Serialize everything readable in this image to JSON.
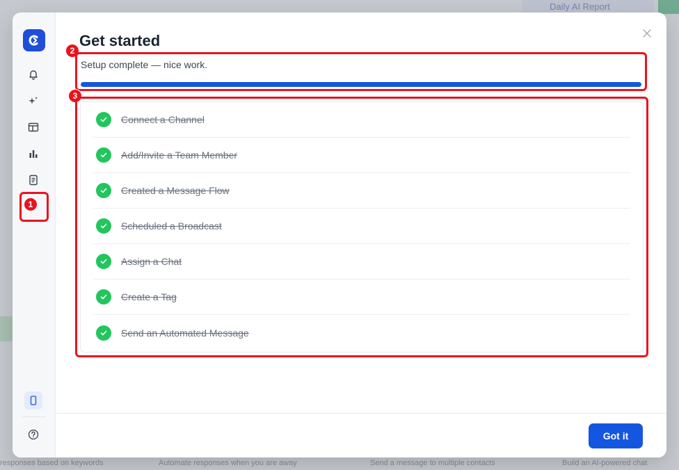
{
  "background": {
    "top_button_label": "Daily AI Report",
    "footer_texts": [
      "responses based on keywords",
      "Automate responses when you are away",
      "Send a message to multiple contacts",
      "Build an AI-powered chat"
    ]
  },
  "sidebar": {
    "logo_icon": "brand-logo-icon",
    "items": [
      {
        "icon": "bell-icon"
      },
      {
        "icon": "sparkle-icon"
      },
      {
        "icon": "layout-icon"
      },
      {
        "icon": "bar-chart-icon"
      },
      {
        "icon": "document-icon"
      }
    ],
    "bottom": [
      {
        "icon": "mobile-icon"
      },
      {
        "icon": "help-icon"
      }
    ]
  },
  "modal": {
    "title": "Get started",
    "progress_text": "Setup complete — nice work.",
    "progress_fraction": 1.0,
    "tasks": [
      {
        "label": "Connect a Channel",
        "done": true
      },
      {
        "label": "Add/Invite a Team Member",
        "done": true
      },
      {
        "label": "Created a Message Flow",
        "done": true
      },
      {
        "label": "Scheduled a Broadcast",
        "done": true
      },
      {
        "label": "Assign a Chat",
        "done": true
      },
      {
        "label": "Create a Tag",
        "done": true
      },
      {
        "label": "Send an Automated Message",
        "done": true
      }
    ],
    "confirm_label": "Got it"
  },
  "annotations": {
    "badge_1": "1",
    "badge_2": "2",
    "badge_3": "3"
  },
  "colors": {
    "accent": "#1556e0",
    "success": "#22c55e",
    "annotation": "#e8131f"
  }
}
